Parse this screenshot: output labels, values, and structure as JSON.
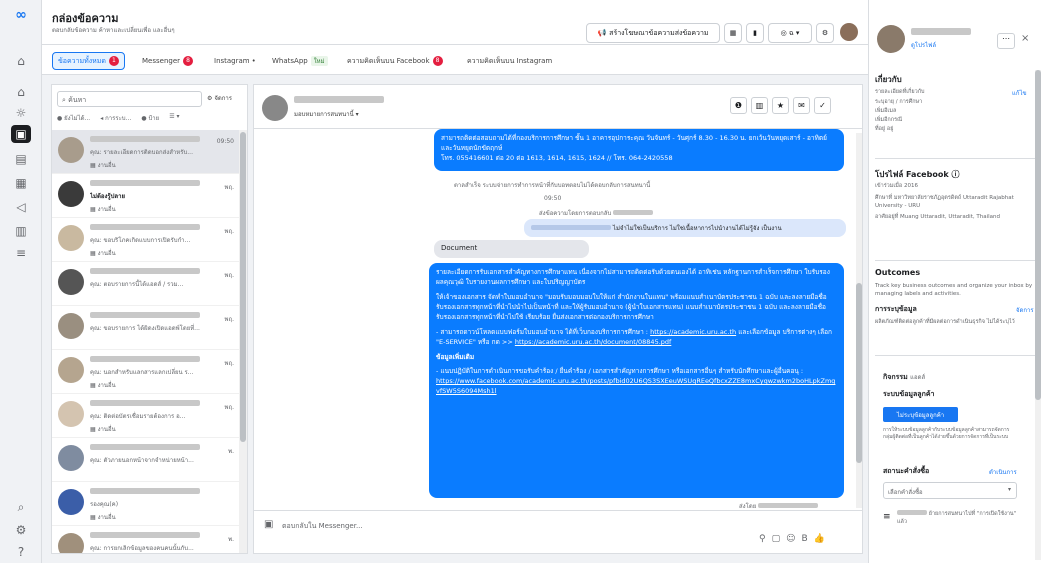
{
  "header": {
    "title": "กล่องข้อความ",
    "subtitle": "ตอบกลับข้อความ ค้าหาและเปลี่ยนเพื่อ และอื่นๆ"
  },
  "toolbar": {
    "create_label": "สร้างโฆษณาข้อความส่งข้อความ",
    "lang_label": "ฉ"
  },
  "tabs": [
    {
      "label": "ข้อความทั้งหมด",
      "badge": "1"
    },
    {
      "label": "Messenger",
      "badge": "8"
    },
    {
      "label": "Instagram",
      "badge": "•"
    },
    {
      "label": "WhatsApp",
      "badge": "ใหม่"
    },
    {
      "label": "ความคิดเห็นบน Facebook",
      "badge": "8"
    },
    {
      "label": "ความคิดเห็นบน Instagram",
      "badge": ""
    }
  ],
  "list": {
    "search_placeholder": "ค้นหา",
    "sort_label": "จัดการ",
    "filters": [
      "ยังไม่ได้...",
      "การระบ...",
      "ป้าย",
      "ตัวกรอง"
    ],
    "items": [
      {
        "preview": "คุณ: รายละเอียดการติดบอกส่งสำหรับ...",
        "time": "09:50",
        "tag": "งานอื่น"
      },
      {
        "preview": "ไม่ต้องรู้ปลาย",
        "time": "พฤ.",
        "tag": "งานอื่น"
      },
      {
        "preview": "คุณ: ขอบริโภคเกิดแบบการเปิดรับกำ...",
        "time": "พฤ.",
        "tag": "งานอื่น"
      },
      {
        "preview": "คุณ: ตอบรายการนี้ได้แอดส์ / รวม...",
        "time": "พฤ.",
        "tag": ""
      },
      {
        "preview": "คุณ: ขอบรายการ ได้ผิดงเปิดแอดพ์โดยที่...",
        "time": "พฤ.",
        "tag": ""
      },
      {
        "preview": "คุณ: นอกสำหรับแลกสารแลกเปลี่ยน ร...",
        "time": "พฤ.",
        "tag": "งานอื่น"
      },
      {
        "preview": "คุณ: ติดต่อบัตรเชื่อมรายต้องการ อ...",
        "time": "พฤ.",
        "tag": "งานอื่น"
      },
      {
        "preview": "คุณ: ตัวภายนอกหน้าจากจำหน่ายหน้า...",
        "time": "พ.",
        "tag": ""
      },
      {
        "preview": "รองคุณ(ค)",
        "time": "",
        "tag": "งานอื่น"
      },
      {
        "preview": "คุณ: การยกเลิกข้อมูลของคนคนนั้นกับ...",
        "time": "พ.",
        "tag": ""
      }
    ]
  },
  "chat": {
    "subtitle": "มอบหมายการสนทนานี้",
    "msg1": "สามารถติดต่อสอบถามได้ที่กองบริการการศึกษา ชั้น 1 อาคารอุปการะคุณ วันจันทร์ - วันศุกร์ 8.30 - 16.30 น. ยกเว้นวันหยุดเสาร์ - อาทิตย์ และวันหยุดนักขัตฤกษ์",
    "msg1_tel": "โทร. 055416601 ต่อ 20 ต่อ 1613, 1614, 1615, 1624 // โทร. 064-2420558",
    "system1": "ตาลสำเร็จ ระบบจ่ายการทำการหน้าที่กับบอทตอบไม่ได้ตอบกลับการสนทนานี้",
    "time1": "09:50",
    "system2": "ส่งข้อความโดยการตอบกลับ",
    "light_msg": "ไม่จำไม่ใช่เป็นบริการ ไม่ใช่เนื้อหาการไปนำงานได้ไม่รู้จัง เป็นงาน",
    "doc_label": "Document",
    "msg2_p1": "รายละเอียดการรับเอกสารสำคัญทางการศึกษาแทน เนื่องจากไม่สามารถติดต่อรับด้วยตนเองได้ อาทิเช่น หลักฐานการสำเร็จการศึกษา ใบรับรองผลคุณวุฒิ ใบรายงานผลการศึกษา และใบปริญญาบัตร",
    "msg2_p2": "ให้เจ้าของเอกสาร จัดทำใบมอบอำนาจ \"มอบรับมอบมอบใบให้แก่ สำนักงานในแทน\" พร้อมแนบสำเนาบัตรประชาชน 1 ฉบับ และลงลายมือชื่อรับรองเอกสารทุกหน้าที่นำไปนำไปเป็นหน้าที่ และให้ผู้รับมอบอำนาจ (ผู้นำใบเอกสารแทน) แนบสำเนาบัตรประชาชน 1 ฉบับ และลงลายมือชื่อรับรองเอกสารทุกหน้าที่นำไปใช้ เรียบร้อย ยื่นส่งเอกสารต่อกองบริการการศึกษา",
    "msg2_p3": "- สามารถดาวน์โหลดแบบฟอร์มใบมอบอำนาจ ได้ที่เว็บกองบริการการศึกษา :",
    "msg2_link1": "https://academic.uru.ac.th",
    "msg2_p4": "และเลือกข้อมูล บริการต่างๆ เลือก \"E-SERVICE\" หรือ กด >>",
    "msg2_link2": "https://academic.uru.ac.th/document/08845.pdf",
    "msg2_p5": "ข้อมูลเพิ่มเติม",
    "msg2_p6": "- แนบปฏิบัติในการดำเนินการขอรับคำร้อง / ยื่นคำร้อง / เอกสารสำคัญทางการศึกษา หรือเอกสารอื่นๆ สำหรับนักศึกษาและผู้อื่นคอนุ :",
    "msg2_link3": "https://www.facebook.com/academic.uru.ac.th/posts/pfbid02U6QS3SXEeuWSUqREeQfbcxZZE8mxCyqwzwkm2boHLpkZmgvfSW5S6094Msh1l",
    "sent_label": "ส่งโดย",
    "composer_placeholder": "ตอบกลับใน Messenger..."
  },
  "right": {
    "profile_link": "ดูโปรไฟล์",
    "about_title": "เกี่ยวกับ",
    "about_rows": [
      "รายละเอียดที่เกี่ยวกับ",
      "ระบุอายุ / การศึกษา",
      "เพิ่มอีเมล",
      "เพิ่มอีกกรณี",
      "ที่อยู่ อยู่"
    ],
    "edit_label": "แก้ไข",
    "fb_profile_title": "โปรไฟล์ Facebook",
    "fb_rows": [
      "เข้าร่วมเมื่อ 2016",
      "ศึกษาที่ มหาวิทยาลัยราชภัฏอุตรดิตถ์ Uttaradit Rajabhat University - URU",
      "อาศัยอยู่ที่ Muang Uttaradit, Uttaradit, Thailand"
    ],
    "outcomes_title": "Outcomes",
    "outcomes_text": "Track key business outcomes and organize your inbox by managing labels and activities.",
    "stage_title": "การระบุข้อมูล",
    "stage_link": "จัดการ",
    "stage_text": "ผลิตภัณฑ์ติดต่อลูกค้าที่มีผลต่อการดำเนินธุรกิจ ไม่ได้ระบุไว้",
    "activity_title": "กิจกรรม",
    "activity_sub": "แอดส์",
    "customer_title": "ระบบข้อมูลลูกค้า",
    "customer_btn": "ไม่ระบุข้อมูลลูกค้า",
    "customer_note": "การให้ระบบข้อมูลลูกค้ากับระบบข้อมูลลูกค้าสามารถจัดการกลุ่มผู้ติดต่อที่เป็นลูกค้าได้ง่ายขึ้นด้วยการจัดการที่เป็นระบบ",
    "status_title": "สถานะคำสั่งซื้อ",
    "status_link": "ดำเนินการ",
    "status_placeholder": "เลือกคำสั่งซื้อ",
    "note": "ย้ายการสนทนาไปที่ \"การเปิดใช้งาน\" แล้ว"
  }
}
